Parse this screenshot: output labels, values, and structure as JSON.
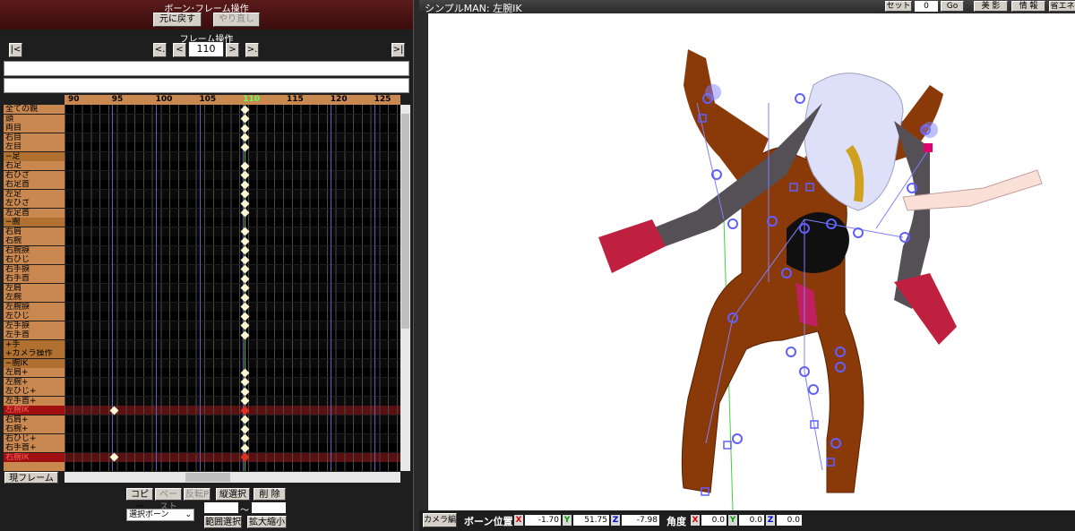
{
  "left_panel": {
    "header_title": "ボーン･フレーム操作",
    "undo_label": "元に戻す",
    "redo_label": "やり直し",
    "frame_ops_title": "フレーム操作",
    "nav": {
      "first": "|<",
      "prev_key": "<.",
      "prev": "<",
      "frame_value": "110",
      "next": ">",
      "next_key": ">.",
      "last": ">|"
    },
    "ruler_ticks": [
      "90",
      "95",
      "100",
      "105",
      "110",
      "115",
      "120",
      "125"
    ],
    "current_frame_tick": "110",
    "rows": [
      {
        "label": "全ての親",
        "type": "bone"
      },
      {
        "label": "頭",
        "type": "bone"
      },
      {
        "label": "両目",
        "type": "bone"
      },
      {
        "label": "右目",
        "type": "bone"
      },
      {
        "label": "左目",
        "type": "bone"
      },
      {
        "label": "−足",
        "type": "cat"
      },
      {
        "label": "右足",
        "type": "bone"
      },
      {
        "label": "右ひざ",
        "type": "bone"
      },
      {
        "label": "右足首",
        "type": "bone"
      },
      {
        "label": "左足",
        "type": "bone"
      },
      {
        "label": "左ひざ",
        "type": "bone"
      },
      {
        "label": "左足首",
        "type": "bone"
      },
      {
        "label": "−腕",
        "type": "cat"
      },
      {
        "label": "右肩",
        "type": "bone"
      },
      {
        "label": "右腕",
        "type": "bone"
      },
      {
        "label": "右腕捩",
        "type": "bone"
      },
      {
        "label": "右ひじ",
        "type": "bone"
      },
      {
        "label": "右手捩",
        "type": "bone"
      },
      {
        "label": "右手首",
        "type": "bone"
      },
      {
        "label": "左肩",
        "type": "bone"
      },
      {
        "label": "左腕",
        "type": "bone"
      },
      {
        "label": "左腕捩",
        "type": "bone"
      },
      {
        "label": "左ひじ",
        "type": "bone"
      },
      {
        "label": "左手捩",
        "type": "bone"
      },
      {
        "label": "左手首",
        "type": "bone"
      },
      {
        "label": "+手",
        "type": "cat"
      },
      {
        "label": "+カメラ操作",
        "type": "cat"
      },
      {
        "label": "−腕IK",
        "type": "cat"
      },
      {
        "label": "左肩+",
        "type": "bone"
      },
      {
        "label": "左腕+",
        "type": "bone"
      },
      {
        "label": "左ひじ+",
        "type": "bone"
      },
      {
        "label": "左手首+",
        "type": "bone"
      },
      {
        "label": "左腕IK",
        "type": "sel"
      },
      {
        "label": "右肩+",
        "type": "bone"
      },
      {
        "label": "右腕+",
        "type": "bone"
      },
      {
        "label": "右ひじ+",
        "type": "bone"
      },
      {
        "label": "右手首+",
        "type": "bone"
      },
      {
        "label": "右腕IK",
        "type": "sel"
      },
      {
        "label": "",
        "type": "bone"
      }
    ],
    "current_frame_button": "現フレーム",
    "copy_label": "コピー",
    "paste_label": "ペースト",
    "reverse_paste_label": "反転P",
    "vertical_select_label": "縦選択",
    "delete_label": "削 除",
    "range_separator": "〜",
    "select_dropdown": "選択ボーン",
    "range_select_label": "範囲選択",
    "zoom_label": "拡大縮小"
  },
  "viewport": {
    "title": "シンプルMAN: 左腕IK",
    "set_label": "セット",
    "set_value": "0",
    "go_label": "Go",
    "beauty_label": "美 影",
    "info_label": "情 報",
    "eco_label": "省エネ"
  },
  "footer": {
    "camera_label": "カメラ編",
    "bone_pos_label": "ボーン位置",
    "pos_x": "-1.70",
    "pos_y": "51.75",
    "pos_z": "-7.98",
    "angle_label": "角度",
    "ang_x": "0.0",
    "ang_y": "0.0",
    "ang_z": "0.0",
    "axis_x": "X",
    "axis_y": "Y",
    "axis_z": "Z"
  },
  "colors": {
    "header_bg": "#5a1a1a",
    "label_bg": "#c88850",
    "selected_row": "#a01010",
    "keyframe": "#fff8d0",
    "current_line": "#40c040"
  }
}
